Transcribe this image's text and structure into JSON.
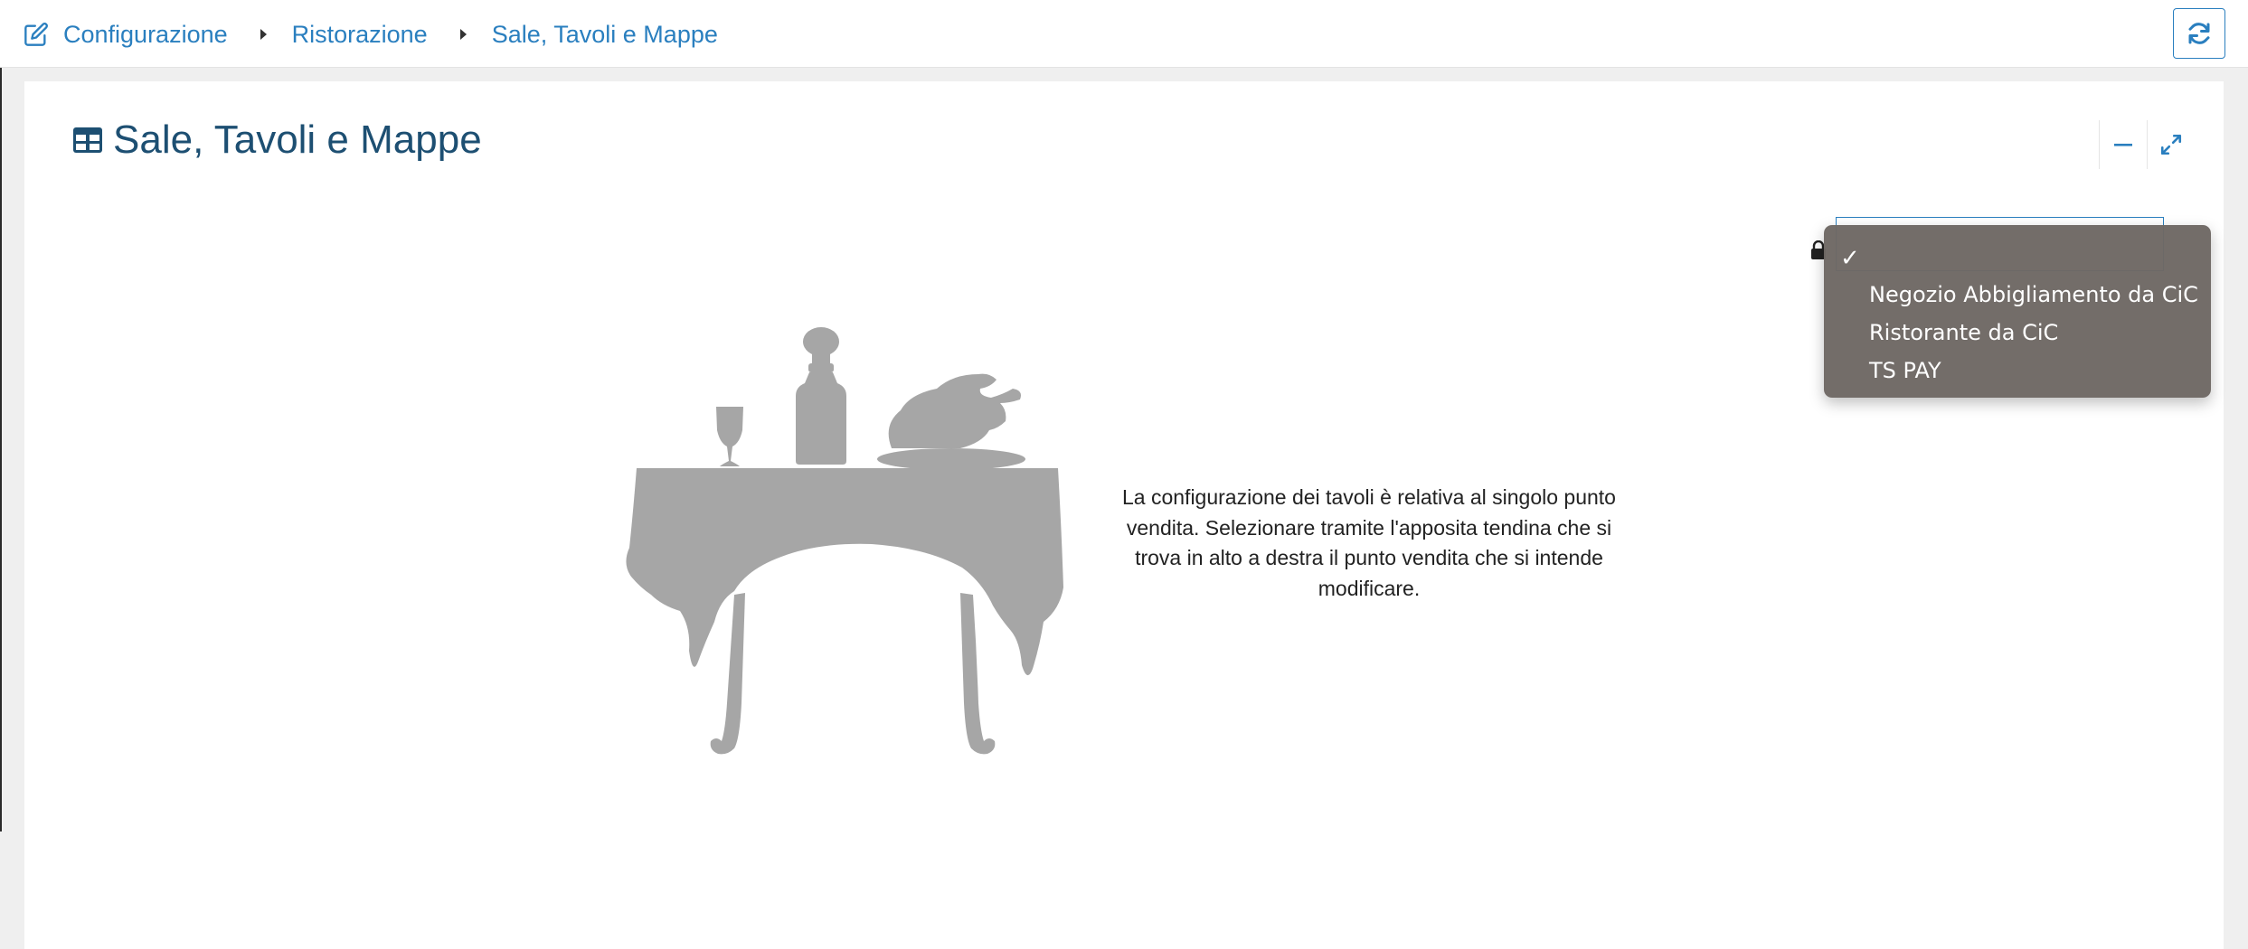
{
  "breadcrumb": {
    "items": [
      {
        "label": "Configurazione"
      },
      {
        "label": "Ristorazione"
      },
      {
        "label": "Sale, Tavoli e Mappe"
      }
    ]
  },
  "panel": {
    "title": "Sale, Tavoli e Mappe"
  },
  "store_select": {
    "options": [
      {
        "label": "",
        "selected": true
      },
      {
        "label": "Negozio Abbigliamento da CiC",
        "selected": false
      },
      {
        "label": "Ristorante da CiC",
        "selected": false
      },
      {
        "label": "TS PAY",
        "selected": false
      }
    ],
    "check_glyph": "✓"
  },
  "message": {
    "text": "La configurazione dei tavoli è relativa al singolo punto vendita. Selezionare tramite l'apposita tendina che si trova in alto a destra il punto vendita che si intende modificare."
  },
  "colors": {
    "link": "#2a7fbf",
    "title": "#1d4f72",
    "dropdown_bg": "#6e6864",
    "illustration": "#a6a6a6"
  },
  "icons": {
    "edit": "edit-icon",
    "refresh": "refresh-icon",
    "table": "table-icon",
    "minimize": "minus-icon",
    "expand": "expand-icon",
    "lock": "lock-icon"
  }
}
